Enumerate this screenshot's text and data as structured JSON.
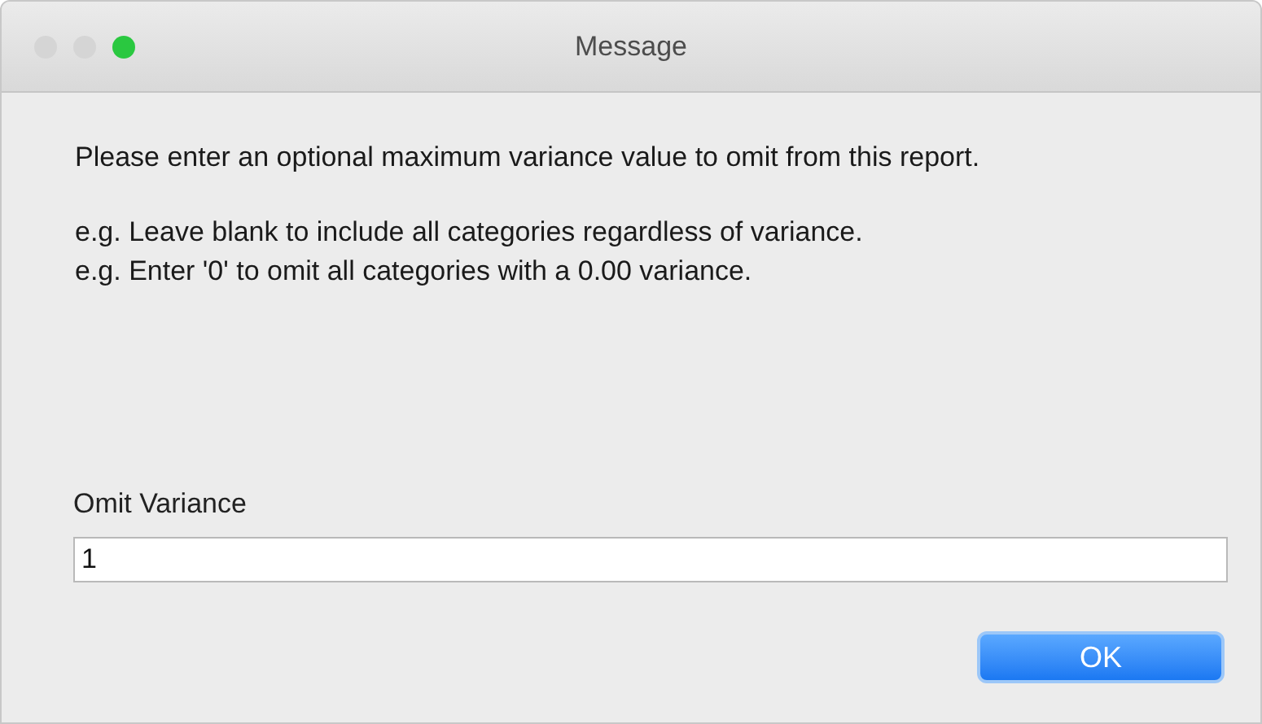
{
  "window": {
    "title": "Message",
    "controls": [
      {
        "color": "#d5d5d5"
      },
      {
        "color": "#d5d5d5"
      },
      {
        "color": "#2ac840"
      }
    ]
  },
  "message": [
    "Please enter an optional maximum variance value to omit from this report.",
    "e.g. Leave blank to include all categories regardless of variance.\ne.g. Enter '0' to omit all categories with a 0.00 variance."
  ],
  "field": {
    "label": "Omit Variance",
    "value": "1"
  },
  "buttons": [
    {
      "label": "OK",
      "default": true
    }
  ]
}
